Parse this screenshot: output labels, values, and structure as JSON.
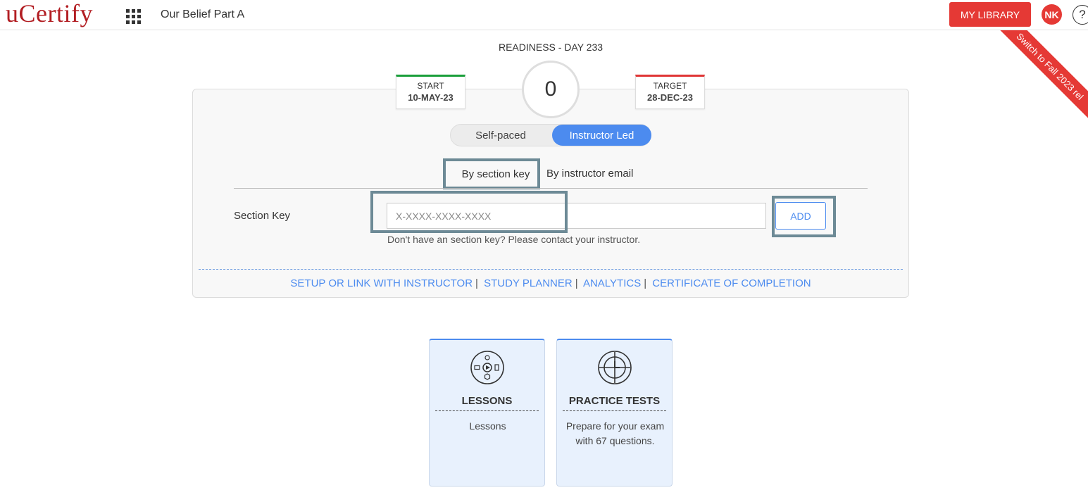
{
  "header": {
    "logo": "uCertify",
    "course_title": "Our Belief Part A",
    "my_library": "MY LIBRARY",
    "avatar_initials": "NK",
    "help": "?"
  },
  "ribbon": {
    "text": "Switch to Fall 2023 rel"
  },
  "readiness": {
    "title": "READINESS - DAY 233",
    "score": "0",
    "start": {
      "label": "START",
      "date": "10-MAY-23"
    },
    "target": {
      "label": "TARGET",
      "date": "28-DEC-23"
    }
  },
  "mode_toggle": {
    "self_paced": "Self-paced",
    "instructor_led": "Instructor Led",
    "selected": "Instructor Led"
  },
  "tabs": {
    "by_section_key": "By section key",
    "by_instructor_email": "By instructor email"
  },
  "section_key": {
    "label": "Section Key",
    "placeholder": "X-XXXX-XXXX-XXXX",
    "value": "",
    "add": "ADD",
    "hint": "Don't have an section key? Please contact your instructor."
  },
  "links": {
    "setup": "SETUP OR LINK WITH INSTRUCTOR",
    "planner": "STUDY PLANNER",
    "analytics": "ANALYTICS",
    "certificate": "CERTIFICATE OF COMPLETION",
    "separator": "|"
  },
  "tiles": [
    {
      "title": "LESSONS",
      "description": "Lessons",
      "icon": "lessons-icon"
    },
    {
      "title": "PRACTICE TESTS",
      "description": "Prepare for your exam with 67 questions.",
      "icon": "target-icon"
    }
  ],
  "colors": {
    "brand_red": "#b21e23",
    "accent_red": "#e53935",
    "accent_blue": "#4c8bef",
    "start_green": "#1a9e3a"
  }
}
